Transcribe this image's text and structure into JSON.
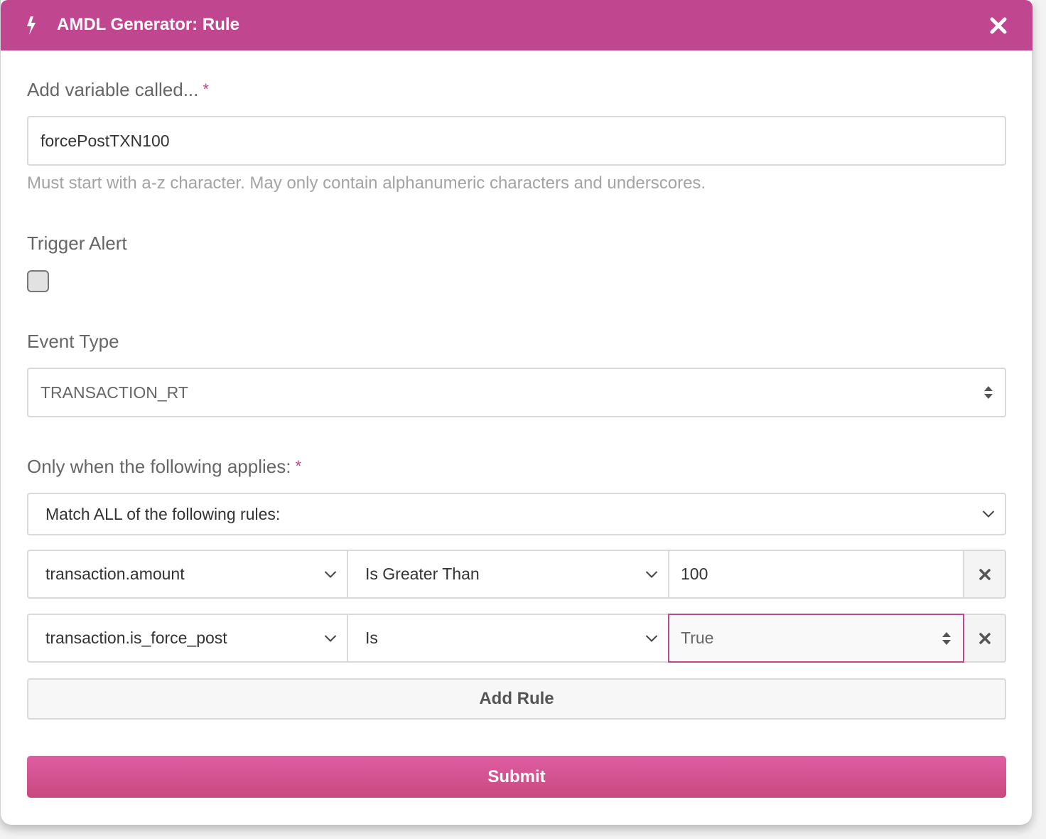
{
  "dialog": {
    "title": "AMDL Generator: Rule"
  },
  "variable": {
    "label": "Add variable called...",
    "required_mark": "*",
    "value": "forcePostTXN100",
    "help": "Must start with a-z character. May only contain alphanumeric characters and underscores."
  },
  "trigger_alert": {
    "label": "Trigger Alert",
    "checked": false
  },
  "event_type": {
    "label": "Event Type",
    "selected": "TRANSACTION_RT"
  },
  "conditions": {
    "label": "Only when the following applies:",
    "required_mark": "*",
    "match_mode": "Match ALL of the following rules:",
    "rules": [
      {
        "field": "transaction.amount",
        "operator": "Is Greater Than",
        "value": "100"
      },
      {
        "field": "transaction.is_force_post",
        "operator": "Is",
        "value": "True"
      }
    ],
    "add_rule_label": "Add Rule"
  },
  "submit_label": "Submit",
  "colors": {
    "accent": "#c04690",
    "submit": "#d4528f"
  },
  "icons": {
    "header": "lightning-bolt-icon",
    "close": "close-icon",
    "remove": "remove-rule-icon",
    "select_updown": "sort-arrows-icon",
    "select_chevron": "chevron-down-icon"
  }
}
